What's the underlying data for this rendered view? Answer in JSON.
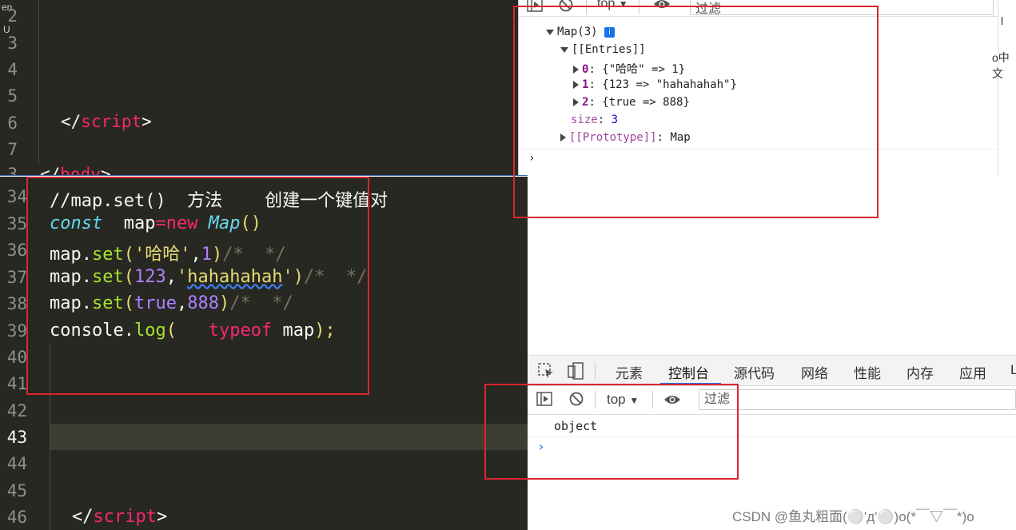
{
  "editor_top": {
    "side_chars": [
      "en",
      "U"
    ],
    "line_numbers": [
      "2",
      "3",
      "4",
      "5",
      "6",
      "7",
      "3"
    ],
    "close_script_open": "</",
    "close_script_tag": "script",
    "close_script_end": ">",
    "close_body_open": "</",
    "close_body_tag": "body",
    "close_body_end": ">"
  },
  "editor_bottom": {
    "line_numbers": [
      "34",
      "35",
      "36",
      "37",
      "38",
      "39",
      "40",
      "41",
      "42",
      "43",
      "44",
      "45",
      "46"
    ],
    "line34": "//map.set()  方法    创建一个键值对",
    "line35": {
      "const": "const",
      "sp": "  ",
      "map": "map",
      "eq": "=",
      "new": "new",
      "sp2": " ",
      "cls": "Map",
      "parens": "()"
    },
    "line36": {
      "obj": "map.",
      "fn": "set",
      "open": "(",
      "str": "'哈哈'",
      "comma": ",",
      "num": "1",
      "close": ")",
      "cmt": "/*  */"
    },
    "line37": {
      "obj": "map.",
      "fn": "set",
      "open": "(",
      "num": "123",
      "comma": ",",
      "str_q1": "'",
      "str": "hahahahah",
      "str_q2": "'",
      "close": ")",
      "cmt": "/*  */"
    },
    "line38": {
      "obj": "map.",
      "fn": "set",
      "open": "(",
      "bool": "true",
      "comma": ",",
      "num": "888",
      "close": ")",
      "cmt": "/*  */"
    },
    "line39": {
      "obj": "console.",
      "fn": "log",
      "open": "(",
      "sp": "   ",
      "kw": "typeof",
      "rest": " map",
      "close": ");"
    },
    "close_script_open": "</",
    "close_script_tag": "script",
    "close_script_end": ">"
  },
  "devtools_top": {
    "top_label": "top",
    "filter_label": "过滤",
    "map_header": "Map(3)",
    "info_icon": "i",
    "entries_label": "[[Entries]]",
    "entries": [
      {
        "key": "0",
        "value": "{\"哈哈\" => 1}"
      },
      {
        "key": "1",
        "value": "{123 => \"hahahahah\"}"
      },
      {
        "key": "2",
        "value": "{true => 888}"
      }
    ],
    "size_key": "size",
    "size_value": "3",
    "prototype_label": "[[Prototype]]",
    "prototype_value": "Map",
    "prompt": "›"
  },
  "right_strip": {
    "top": "l",
    "mid": "o中文"
  },
  "devtools_bottom": {
    "tabs": [
      "元素",
      "控制台",
      "源代码",
      "网络",
      "性能",
      "内存",
      "应用",
      "L"
    ],
    "active_tab": "控制台",
    "top_label": "top",
    "filter_label": "过滤",
    "output": "object",
    "prompt": "›"
  },
  "watermark": "CSDN @鱼丸粗面(⚪'д'⚪)o(*￣▽￣*)o",
  "colors": {
    "editor_bg": "#272822",
    "highlight_red": "#d9262e",
    "devtools_blue": "#1a73e8"
  }
}
